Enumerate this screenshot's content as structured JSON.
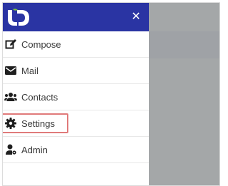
{
  "header": {
    "logo_text": "UD",
    "close_symbol": "✕",
    "background_color": "#2a34a3",
    "logo_color": "#ffffff",
    "logo_accent_color": "#7ac143"
  },
  "menu": {
    "items": [
      {
        "label": "Compose",
        "icon": "compose-icon"
      },
      {
        "label": "Mail",
        "icon": "mail-icon"
      },
      {
        "label": "Contacts",
        "icon": "contacts-icon"
      },
      {
        "label": "Settings",
        "icon": "gear-icon",
        "highlighted": true
      },
      {
        "label": "Admin",
        "icon": "admin-icon"
      }
    ]
  },
  "colors": {
    "overlay": "#a4a7a8",
    "highlight_border": "#e07a7a",
    "menu_text": "#3b3b3b",
    "icon_color": "#1f1f1f"
  }
}
